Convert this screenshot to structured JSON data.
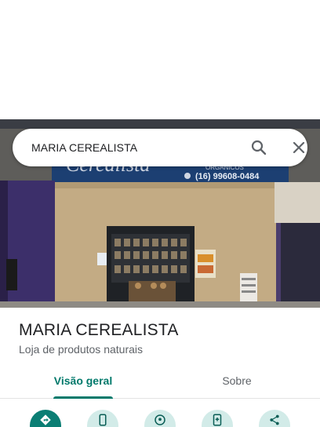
{
  "search": {
    "query": "MARIA CEREALISTA"
  },
  "storefront": {
    "sign_text": "Cerealista",
    "sign_subtext": "ORGÂNICOS",
    "phone": "(16) 99608-0484"
  },
  "place": {
    "title": "MARIA CEREALISTA",
    "category": "Loja de produtos naturais"
  },
  "tabs": [
    {
      "label": "Visão geral",
      "active": true
    },
    {
      "label": "Sobre",
      "active": false
    }
  ],
  "actions": [
    {
      "icon": "directions-icon"
    },
    {
      "icon": "phone-icon"
    },
    {
      "icon": "location-icon"
    },
    {
      "icon": "save-icon"
    },
    {
      "icon": "share-icon"
    }
  ],
  "colors": {
    "accent": "#00796b",
    "action_primary": "#0b7e74",
    "action_tint": "#d2ebe8"
  }
}
